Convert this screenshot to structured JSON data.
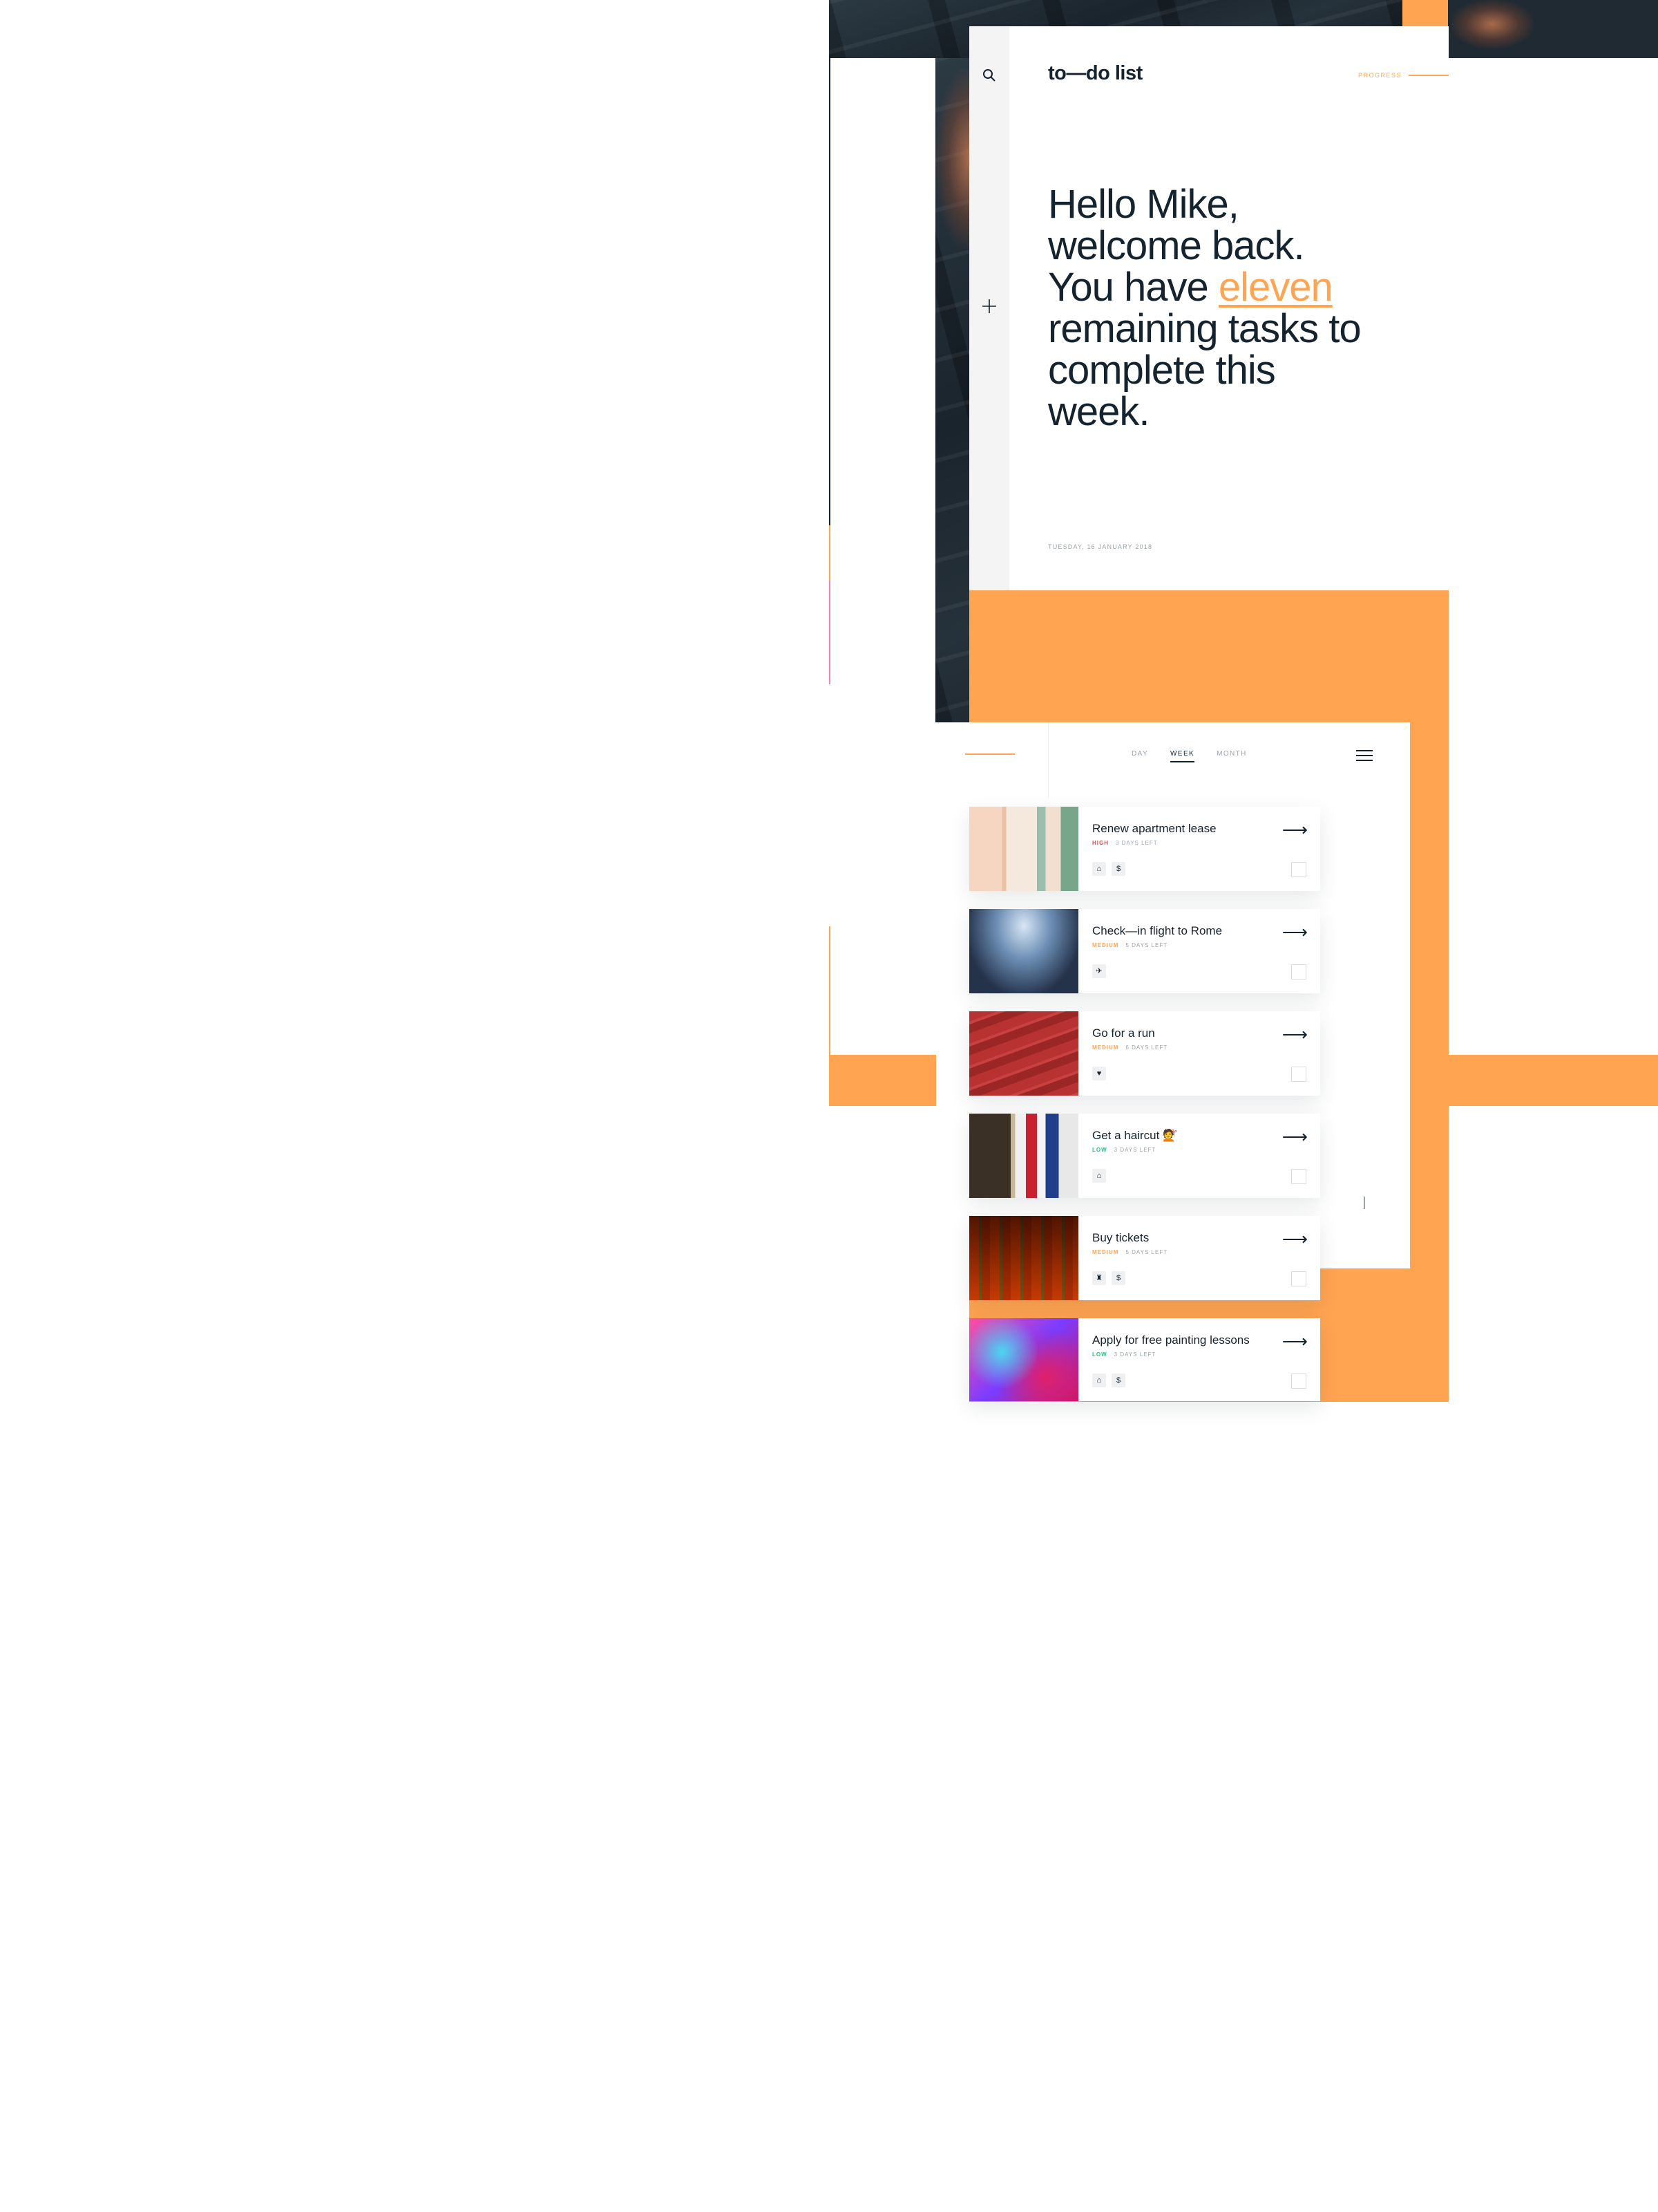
{
  "header": {
    "brand": "to—do list",
    "progress_label": "PROGRESS"
  },
  "greeting": {
    "line_before": "Hello Mike, welcome back. You have ",
    "highlight": "eleven",
    "line_after": " remaining tasks to complete this week."
  },
  "date": "TUESDAY, 16 JANUARY 2018",
  "tabs": [
    {
      "label": "DAY"
    },
    {
      "label": "WEEK",
      "active": true
    },
    {
      "label": "MONTH"
    }
  ],
  "tasks": [
    {
      "title": "Renew apartment lease",
      "priority": "HIGH",
      "days_left": "3 DAYS LEFT",
      "icons": [
        "home-icon",
        "dollar-icon"
      ]
    },
    {
      "title": "Check—in flight to Rome",
      "priority": "MEDIUM",
      "days_left": "5 DAYS LEFT",
      "icons": [
        "plane-icon"
      ]
    },
    {
      "title": "Go for a run",
      "priority": "MEDIUM",
      "days_left": "6 DAYS LEFT",
      "icons": [
        "heart-icon"
      ]
    },
    {
      "title": "Get a haircut 💇",
      "priority": "LOW",
      "days_left": "3 DAYS LEFT",
      "icons": [
        "home-icon"
      ]
    },
    {
      "title": "Buy tickets",
      "priority": "MEDIUM",
      "days_left": "5 DAYS LEFT",
      "icons": [
        "trophy-icon",
        "dollar-icon"
      ]
    },
    {
      "title": "Apply for free painting lessons",
      "priority": "LOW",
      "days_left": "3 DAYS LEFT",
      "icons": [
        "home-icon",
        "dollar-icon"
      ]
    }
  ],
  "colors": {
    "accent": "#ffa451",
    "text_dark": "#14232d",
    "priority_high": "#e24c4b",
    "priority_medium": "#ffa451",
    "priority_low": "#26c281"
  }
}
